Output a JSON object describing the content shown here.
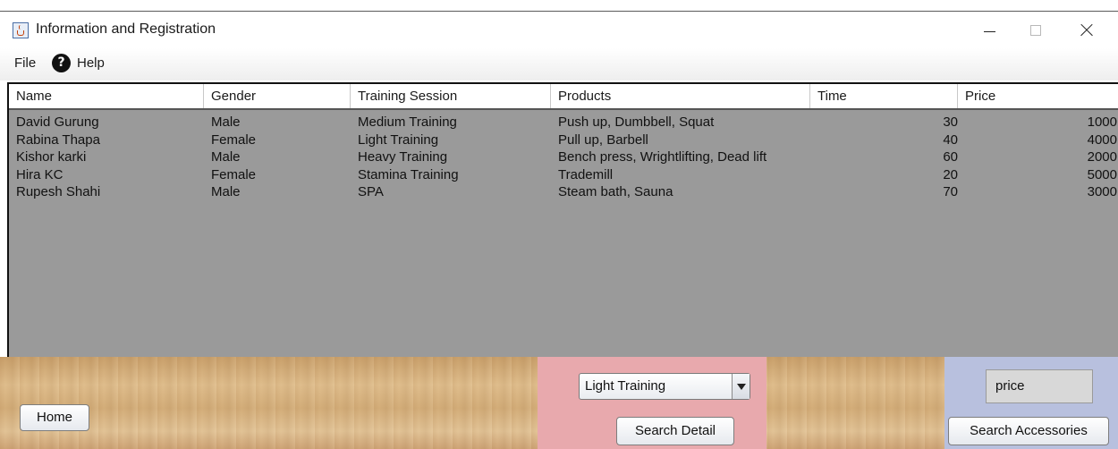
{
  "window": {
    "title": "Information and Registration",
    "app_icon": "java-cup-icon",
    "controls": [
      "minimize-icon",
      "maximize-icon",
      "close-icon"
    ]
  },
  "menubar": {
    "file": "File",
    "help": "Help",
    "help_icon": "question-mark-circle-icon"
  },
  "table": {
    "columns": [
      "Name",
      "Gender",
      "Training Session",
      "Products",
      "Time",
      "Price"
    ],
    "rows": [
      [
        "David Gurung",
        "Male",
        "Medium Training",
        "Push up, Dumbbell, Squat",
        "30",
        "1000"
      ],
      [
        "Rabina Thapa",
        "Female",
        "Light Training",
        "Pull up, Barbell",
        "40",
        "4000"
      ],
      [
        "Kishor karki",
        "Male",
        "Heavy Training",
        "Bench press, Wrightlifting, Dead lift",
        "60",
        "2000"
      ],
      [
        "Hira KC",
        "Female",
        "Stamina Training",
        "Trademill",
        "20",
        "5000"
      ],
      [
        "Rupesh Shahi",
        "Male",
        "SPA",
        "Steam bath, Sauna",
        "70",
        "3000"
      ]
    ]
  },
  "bottom": {
    "home_label": "Home",
    "session_selected": "Light Training",
    "search_detail_label": "Search Detail",
    "price_value": "price",
    "search_accessories_label": "Search Accessories"
  },
  "colors": {
    "table_body": "#9a9a9a",
    "session_panel": "#e8a9ad",
    "price_panel": "#b8c0de",
    "wood": "#d9b482"
  }
}
